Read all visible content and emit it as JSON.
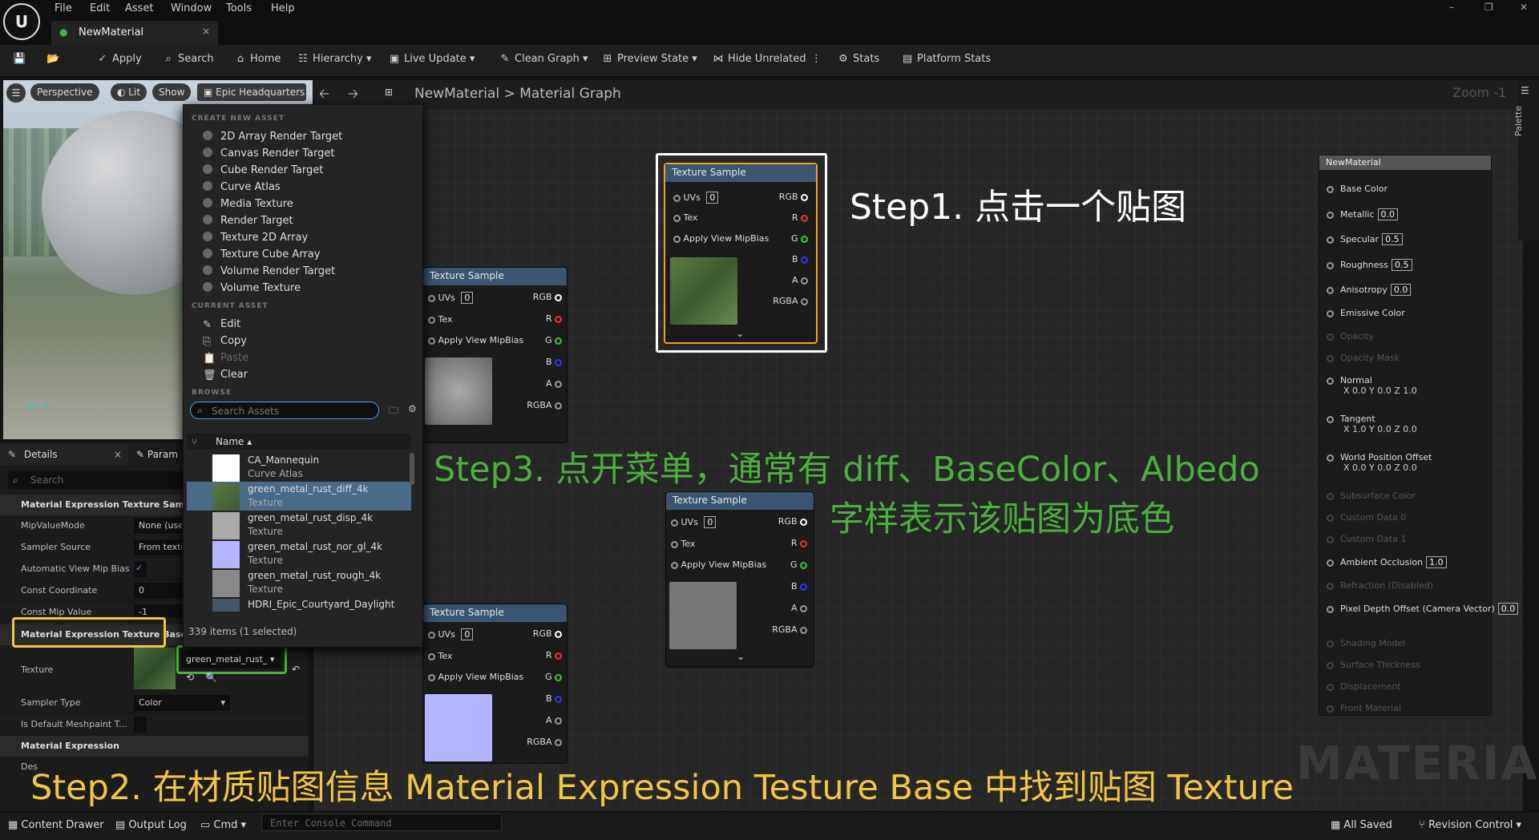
{
  "menus": [
    "File",
    "Edit",
    "Asset",
    "Window",
    "Tools",
    "Help"
  ],
  "tab": {
    "title": "NewMaterial",
    "close": "×"
  },
  "toolbar": {
    "apply": "Apply",
    "search": "Search",
    "home": "Home",
    "hierarchy": "Hierarchy",
    "live_update": "Live Update",
    "clean_graph": "Clean Graph",
    "preview_state": "Preview State",
    "hide_unrelated": "Hide Unrelated",
    "stats": "Stats",
    "platform_stats": "Platform Stats"
  },
  "viewport": {
    "perspective": "Perspective",
    "lit": "Lit",
    "show": "Show",
    "hdri": "Epic Headquarters"
  },
  "breadcrumb": {
    "root": "NewMaterial",
    "sep": ">",
    "child": "Material Graph"
  },
  "zoom": "Zoom -1",
  "palette": "Palette",
  "details": {
    "tab": "Details",
    "tab2": "Param",
    "search": "Search",
    "section1": "Material Expression Texture Sample",
    "rows1": [
      {
        "label": "MipValueMode",
        "value": "None (use"
      },
      {
        "label": "Sampler Source",
        "value": "From textu"
      },
      {
        "label": "Automatic View Mip Bias",
        "value": "✓"
      },
      {
        "label": "Const Coordinate",
        "value": "0"
      },
      {
        "label": "Const Mip Value",
        "value": "-1"
      }
    ],
    "section2": "Material Expression Texture Base",
    "texture_label": "Texture",
    "texture_value": "green_metal_rust_",
    "sampler_type_label": "Sampler Type",
    "sampler_type_value": "Color",
    "meshpaint_label": "Is Default Meshpaint T...",
    "section3": "Material Expression",
    "desc_label": "Des"
  },
  "context_menu": {
    "create_header": "CREATE NEW ASSET",
    "create_items": [
      "2D Array Render Target",
      "Canvas Render Target",
      "Cube Render Target",
      "Curve Atlas",
      "Media Texture",
      "Render Target",
      "Texture 2D Array",
      "Texture Cube Array",
      "Volume Render Target",
      "Volume Texture"
    ],
    "current_header": "CURRENT ASSET",
    "current_items": [
      "Edit",
      "Copy",
      "Paste",
      "Clear"
    ],
    "browse_header": "BROWSE",
    "search_placeholder": "Search Assets",
    "name_col": "Name",
    "assets": [
      {
        "name": "CA_Mannequin",
        "type": "Curve Atlas"
      },
      {
        "name": "green_metal_rust_diff_4k",
        "type": "Texture"
      },
      {
        "name": "green_metal_rust_disp_4k",
        "type": "Texture"
      },
      {
        "name": "green_metal_rust_nor_gl_4k",
        "type": "Texture"
      },
      {
        "name": "green_metal_rust_rough_4k",
        "type": "Texture"
      },
      {
        "name": "HDRI_Epic_Courtyard_Daylight",
        "type": ""
      }
    ],
    "footer": "339 items (1 selected)"
  },
  "node": {
    "title": "Texture Sample",
    "uvs": "UVs",
    "uvs_val": "0",
    "tex": "Tex",
    "mip": "Apply View MipBias",
    "outputs": [
      "RGB",
      "R",
      "G",
      "B",
      "A",
      "RGBA"
    ]
  },
  "result": {
    "title": "NewMaterial",
    "pins": [
      {
        "label": "Base Color",
        "val": ""
      },
      {
        "label": "Metallic",
        "val": "0.0"
      },
      {
        "label": "Specular",
        "val": "0.5"
      },
      {
        "label": "Roughness",
        "val": "0.5"
      },
      {
        "label": "Anisotropy",
        "val": "0.0"
      },
      {
        "label": "Emissive Color",
        "val": ""
      },
      {
        "label": "Opacity",
        "val": ""
      },
      {
        "label": "Opacity Mask",
        "val": ""
      },
      {
        "label": "Normal",
        "val": "X 0.0 Y 0.0 Z 1.0"
      },
      {
        "label": "Tangent",
        "val": "X 1.0 Y 0.0 Z 0.0"
      },
      {
        "label": "World Position Offset",
        "val": "X 0.0 Y 0.0 Z 0.0"
      },
      {
        "label": "Subsurface Color",
        "val": ""
      },
      {
        "label": "Custom Data 0",
        "val": ""
      },
      {
        "label": "Custom Data 1",
        "val": ""
      },
      {
        "label": "Ambient Occlusion",
        "val": "1.0"
      },
      {
        "label": "Refraction (Disabled)",
        "val": ""
      },
      {
        "label": "Pixel Depth Offset (Camera Vector)",
        "val": "0.0"
      },
      {
        "label": "Shading Model",
        "val": ""
      },
      {
        "label": "Surface Thickness",
        "val": ""
      },
      {
        "label": "Displacement",
        "val": ""
      },
      {
        "label": "Front Material",
        "val": ""
      }
    ]
  },
  "watermark": "MATERIAL",
  "annotations": {
    "step1": "Step1. 点击一个贴图",
    "step3a": "Step3. 点开菜单，通常有 diff、BaseColor、Albedo",
    "step3b": "字样表示该贴图为底色",
    "step2": "Step2. 在材质贴图信息 Material Expression Testure Base 中找到贴图 Texture"
  },
  "statusbar": {
    "content_drawer": "Content Drawer",
    "output_log": "Output Log",
    "cmd": "Cmd",
    "console_placeholder": "Enter Console Command",
    "all_saved": "All Saved",
    "revision_control": "Revision Control"
  },
  "colors": {
    "yellow": "#f2c542",
    "green": "#4caf3f",
    "white": "#ffffff"
  }
}
